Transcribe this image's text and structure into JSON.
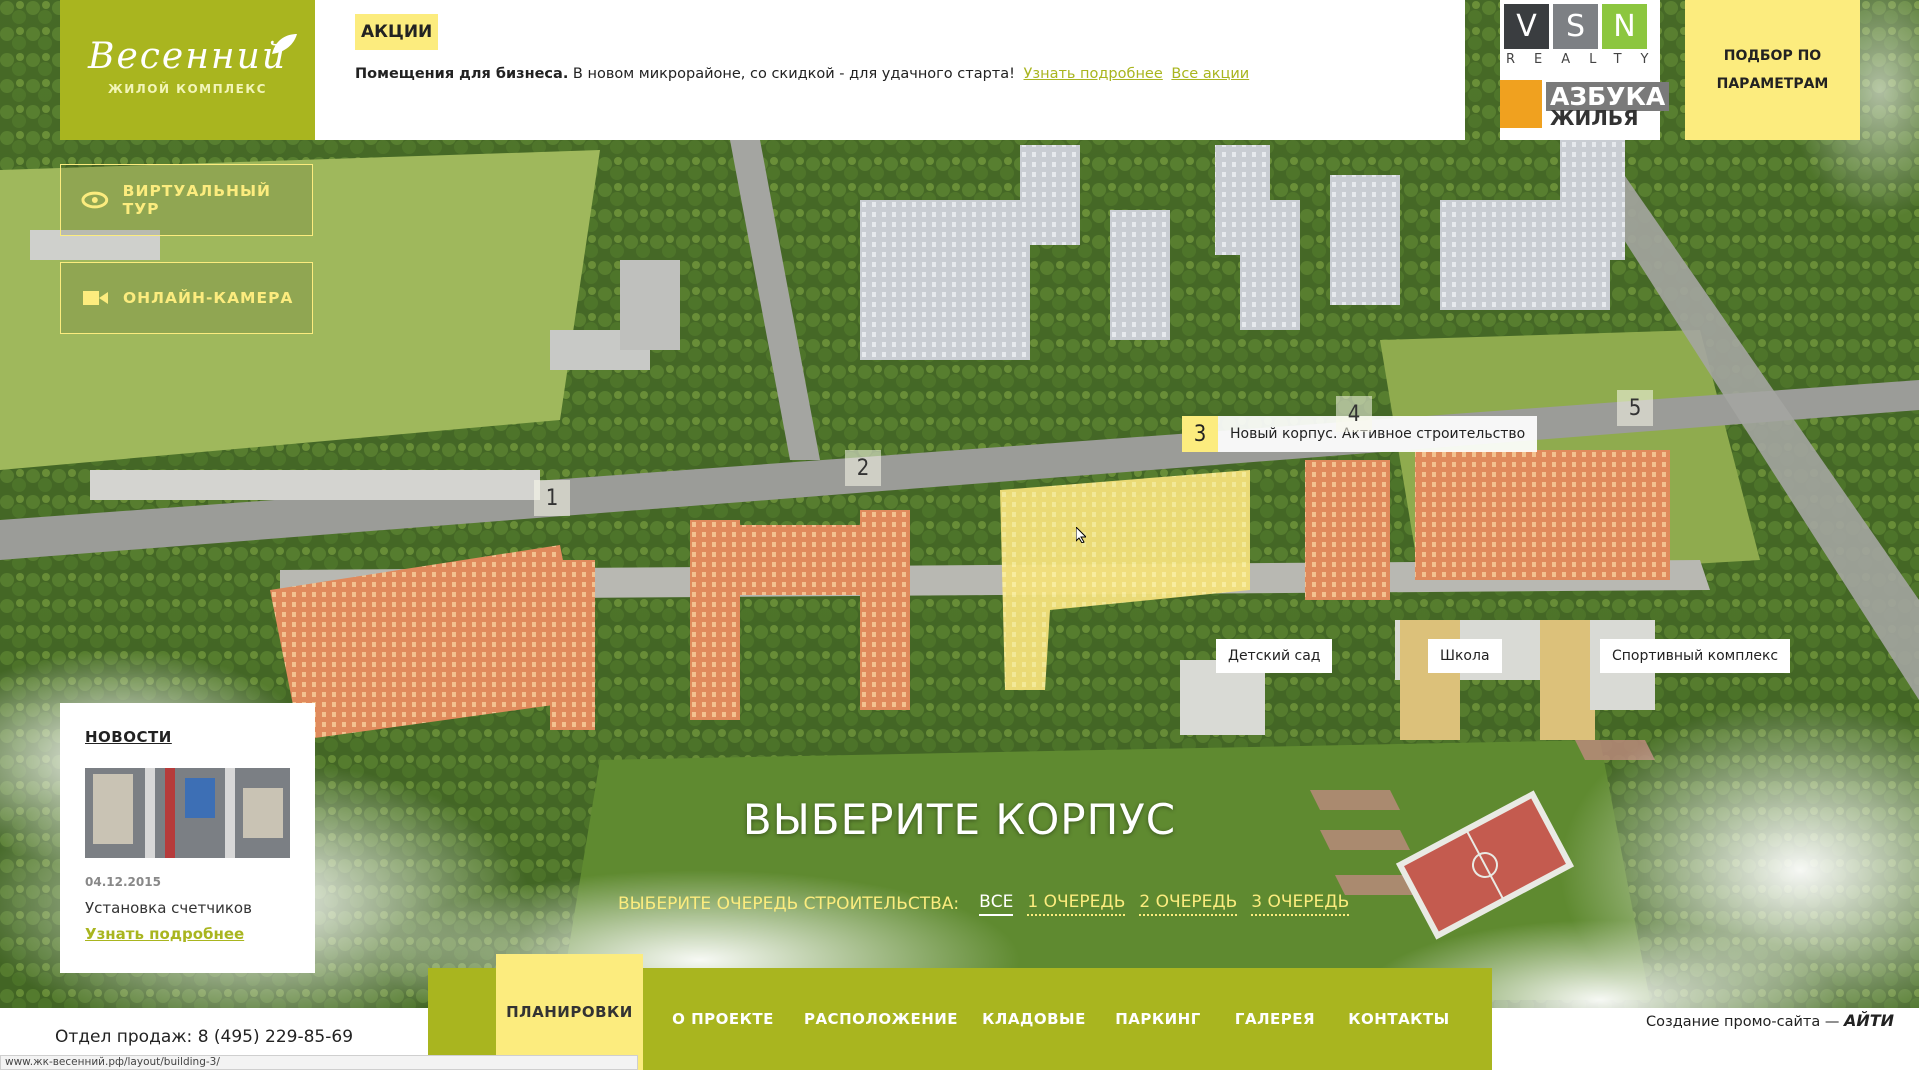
{
  "logo": {
    "name": "Весенний",
    "subtitle": "ЖИЛОЙ КОМПЛЕКС"
  },
  "promo": {
    "badge": "АКЦИИ",
    "bold": "Помещения для бизнеса.",
    "text": " В новом микрорайоне, со скидкой - для удачного старта!",
    "link_more": "Узнать подробнее",
    "link_all": "Все акции"
  },
  "partners": {
    "vsn_letters": [
      "V",
      "S",
      "N"
    ],
    "vsn_colors": [
      "#3a3d40",
      "#7d8084",
      "#8cc63f"
    ],
    "realty": "REALTY",
    "azbuka_line1": "АЗБУКА",
    "azbuka_line2": "ЖИЛЬЯ"
  },
  "param_button": {
    "line1": "ПОДБОР ПО",
    "line2": "ПАРАМЕТРАМ"
  },
  "side_buttons": [
    {
      "label": "ВИРТУАЛЬНЫЙ ТУР",
      "icon": "eye-icon"
    },
    {
      "label": "ОНЛАЙН-КАМЕРА",
      "icon": "video-camera-icon"
    }
  ],
  "news": {
    "title": "НОВОСТИ",
    "date": "04.12.2015",
    "headline": "Установка счетчиков",
    "link": "Узнать подробнее"
  },
  "buildings": [
    {
      "num": "1"
    },
    {
      "num": "2"
    },
    {
      "num": "3",
      "label": "Новый корпус. Активное строительство",
      "active": true
    },
    {
      "num": "4"
    },
    {
      "num": "5"
    }
  ],
  "places": {
    "kindergarten": "Детский сад",
    "school": "Школа",
    "sport": "Спортивный комплекс"
  },
  "choose_title": "ВЫБЕРИТЕ КОРПУС",
  "queue": {
    "label": "ВЫБЕРИТЕ ОЧЕРЕДЬ СТРОИТЕЛЬСТВА:",
    "options": [
      "ВСЕ",
      "1 ОЧЕРЕДЬ",
      "2 ОЧЕРЕДЬ",
      "3 ОЧЕРЕДЬ"
    ],
    "active": "ВСЕ"
  },
  "nav": {
    "items": [
      "ПЛАНИРОВКИ",
      "О ПРОЕКТЕ",
      "РАСПОЛОЖЕНИЕ",
      "КЛАДОВЫЕ",
      "ПАРКИНГ",
      "ГАЛЕРЕЯ",
      "КОНТАКТЫ"
    ],
    "active": "ПЛАНИРОВКИ"
  },
  "sales": "Отдел продаж: 8 (495) 229-85-69",
  "credit": {
    "text": "Создание промо-сайта —",
    "brand": "АЙТИ"
  },
  "status_url": "www.жк-весенний.рф/layout/building-3/",
  "colors": {
    "olive": "#a9b51f",
    "yellow": "#fcec7e"
  }
}
